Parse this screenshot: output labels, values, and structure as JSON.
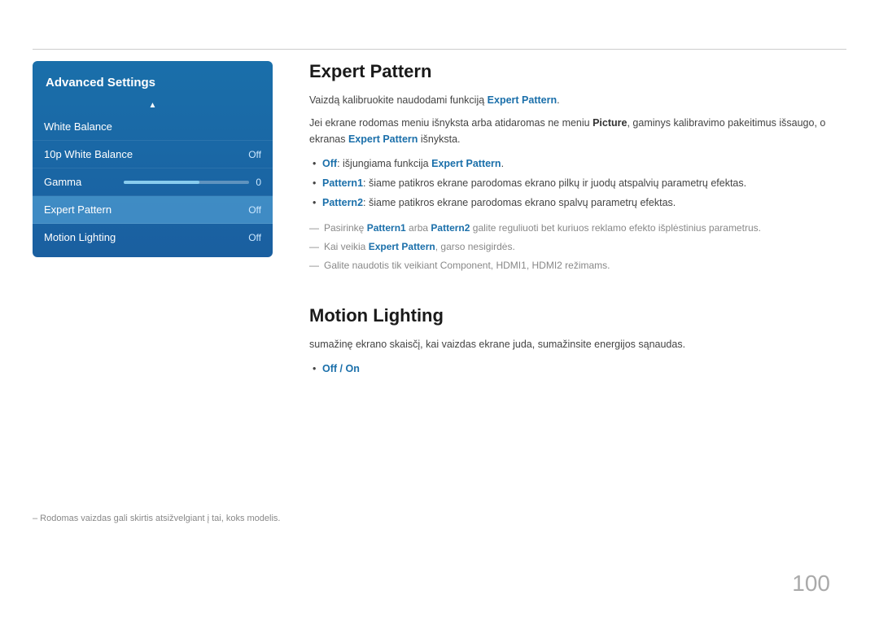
{
  "topLine": true,
  "sidebar": {
    "title": "Advanced Settings",
    "arrowUp": "▲",
    "items": [
      {
        "label": "White Balance",
        "value": "",
        "active": false
      },
      {
        "label": "10p White Balance",
        "value": "Off",
        "active": false
      },
      {
        "label": "Gamma",
        "value": "0",
        "hasSlider": true,
        "active": false
      },
      {
        "label": "Expert Pattern",
        "value": "Off",
        "active": true
      },
      {
        "label": "Motion Lighting",
        "value": "Off",
        "active": false
      }
    ]
  },
  "expertPattern": {
    "title": "Expert Pattern",
    "intro1_pre": "Vaizdą kalibruokite naudodami funkciją ",
    "intro1_bold": "Expert Pattern",
    "intro1_post": ".",
    "intro2_pre": "Jei ekrane rodomas meniu išnyksta arba atidaromas ne meniu ",
    "intro2_bold1": "Picture",
    "intro2_mid": ", gaminys kalibravimo pakeitimus išsaugo, o ekranas ",
    "intro2_bold2": "Expert Pattern",
    "intro2_post": " išnyksta.",
    "bullets": [
      {
        "bold": "Off",
        "bold_suffix": ":",
        "text": " išjungiama funkcija ",
        "bold2": "Expert Pattern",
        "text2": "."
      },
      {
        "bold": "Pattern1",
        "bold_suffix": ":",
        "text": " šiame patikros ekrane parodomas ekrano pilkų ir juodų atspalvių parametrų efektas.",
        "bold2": "",
        "text2": ""
      },
      {
        "bold": "Pattern2",
        "bold_suffix": ":",
        "text": " šiame patikros ekrane parodomas ekrano spalvų parametrų efektas.",
        "bold2": "",
        "text2": ""
      }
    ],
    "dash1_pre": "Pasirinkę ",
    "dash1_bold1": "Pattern1",
    "dash1_mid": " arba ",
    "dash1_bold2": "Pattern2",
    "dash1_post": " galite reguliuoti bet kuriuos reklamo efekto išplėstinius parametrus.",
    "dash2_pre": "Kai veikia ",
    "dash2_bold": "Expert Pattern",
    "dash2_post": ", garso nesigirdės.",
    "dash3_pre": "Galite naudotis tik veikiant ",
    "dash3_bold1": "Component",
    "dash3_sep1": ", ",
    "dash3_bold2": "HDMI1",
    "dash3_sep2": ", ",
    "dash3_bold3": "HDMI2",
    "dash3_post": " režimams."
  },
  "motionLighting": {
    "title": "Motion Lighting",
    "body": "sumažinę ekrano skaisčį, kai vaizdas ekrane juda, sumažinsite energijos sąnaudas.",
    "bullet_bold": "Off / On"
  },
  "footer": {
    "note": "– Rodomas vaizdas gali skirtis atsižvelgiant į tai, koks modelis."
  },
  "pageNumber": "100"
}
